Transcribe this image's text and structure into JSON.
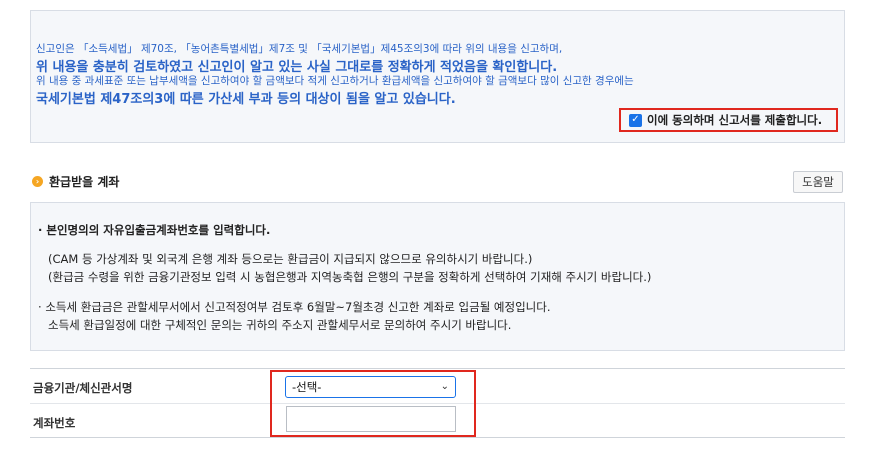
{
  "declaration": {
    "line1": "신고인은 「소득세법」 제70조, 「농어촌특별세법」제7조 및 「국세기본법」제45조의3에 따라 위의 내용을 신고하며,",
    "line2": "위 내용을 충분히 검토하였고 신고인이 알고 있는 사실 그대로를 정확하게 적었음을 확인합니다.",
    "line3": "위 내용 중 과세표준 또는 납부세액을 신고하여야 할 금액보다 적게 신고하거나 환급세액을 신고하여야 할 금액보다 많이 신고한 경우에는",
    "line4": "국세기본법 제47조의3에 따른 가산세 부과 등의 대상이 됨을 알고 있습니다.",
    "agree_label": "이에 동의하며 신고서를 제출합니다.",
    "agree_checked": true
  },
  "refund_section": {
    "title": "환급받을 계좌",
    "help_button": "도움말"
  },
  "notice": {
    "item1_title": "본인명의의 자유입출금계좌번호를 입력합니다.",
    "item1_line1": "(CAM 등 가상계좌 및 외국계 은행 계좌 등으로는 환급금이 지급되지 않으므로 유의하시기 바랍니다.)",
    "item1_line2": "(환급금 수령을 위한 금융기관정보 입력 시 농협은행과 지역농축협 은행의 구분을 정확하게 선택하여 기재해 주시기 바랍니다.)",
    "item2_line1": "소득세 환급금은 관할세무서에서 신고적정여부 검토후 6월말~7월초경 신고한 계좌로 입금될 예정입니다.",
    "item2_line2": "소득세 환급일정에 대한 구체적인 문의는 귀하의 주소지 관할세무서로 문의하여 주시기 바랍니다."
  },
  "form": {
    "bank_label": "금융기관/체신관서명",
    "bank_selected": "-선택-",
    "account_label": "계좌번호",
    "account_value": ""
  },
  "icons": {
    "checkbox": "checkbox-checked-icon",
    "bullet": "orange-circle-bullet-icon",
    "dropdown": "chevron-down-icon"
  },
  "colors": {
    "declaration_text": "#2a63c7",
    "highlight_border": "#e0281e",
    "checkbox": "#1a73e8",
    "section_bullet": "#f5a623"
  }
}
